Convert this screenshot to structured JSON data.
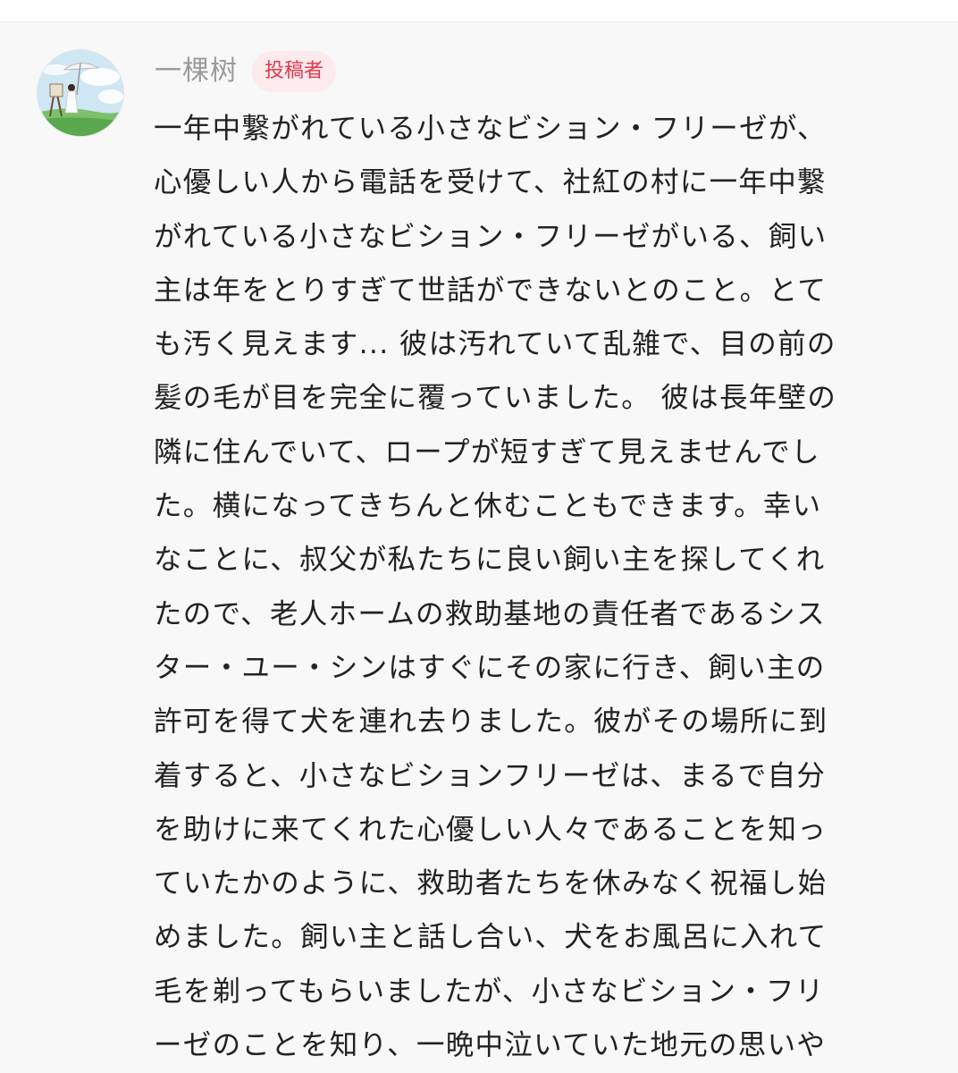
{
  "comment": {
    "author": {
      "name": "一棵树",
      "avatar_icon": "avatar-illustration-icon",
      "badge": "投稿者"
    },
    "body_lines": [
      "一年中繋がれている小さなビション・フリーゼが、",
      "心優しい人から電話を受けて、社紅の村に一年中繋",
      "がれている小さなビション・フリーゼがいる、飼い",
      "主は年をとりすぎて世話ができないとのこと。とて",
      "も汚く見えます... 彼は汚れていて乱雑で、目の前の",
      "髪の毛が目を完全に覆っていました。 彼は長年壁の",
      "隣に住んでいて、ロープが短すぎて見えませんでし",
      "た。横になってきちんと休むこともできます。幸い",
      "なことに、叔父が私たちに良い飼い主を探してくれ",
      "たので、老人ホームの救助基地の責任者であるシス",
      "ター・ユー・シンはすぐにその家に行き、飼い主の",
      "許可を得て犬を連れ去りました。彼がその場所に到",
      "着すると、小さなビションフリーゼは、まるで自分",
      "を助けに来てくれた心優しい人々であることを知っ",
      "ていたかのように、救助者たちを休みなく祝福し始",
      "めました。飼い主と話し合い、犬をお風呂に入れて",
      "毛を剃ってもらいましたが、小さなビション・フリ",
      "ーゼのことを知り、一晩中泣いていた地元の思いや"
    ]
  },
  "colors": {
    "background": "#f8f8f8",
    "author_name": "#9a9a9a",
    "badge_text": "#e0394e",
    "badge_bg": "#fdeaec",
    "body_text": "#222222"
  }
}
